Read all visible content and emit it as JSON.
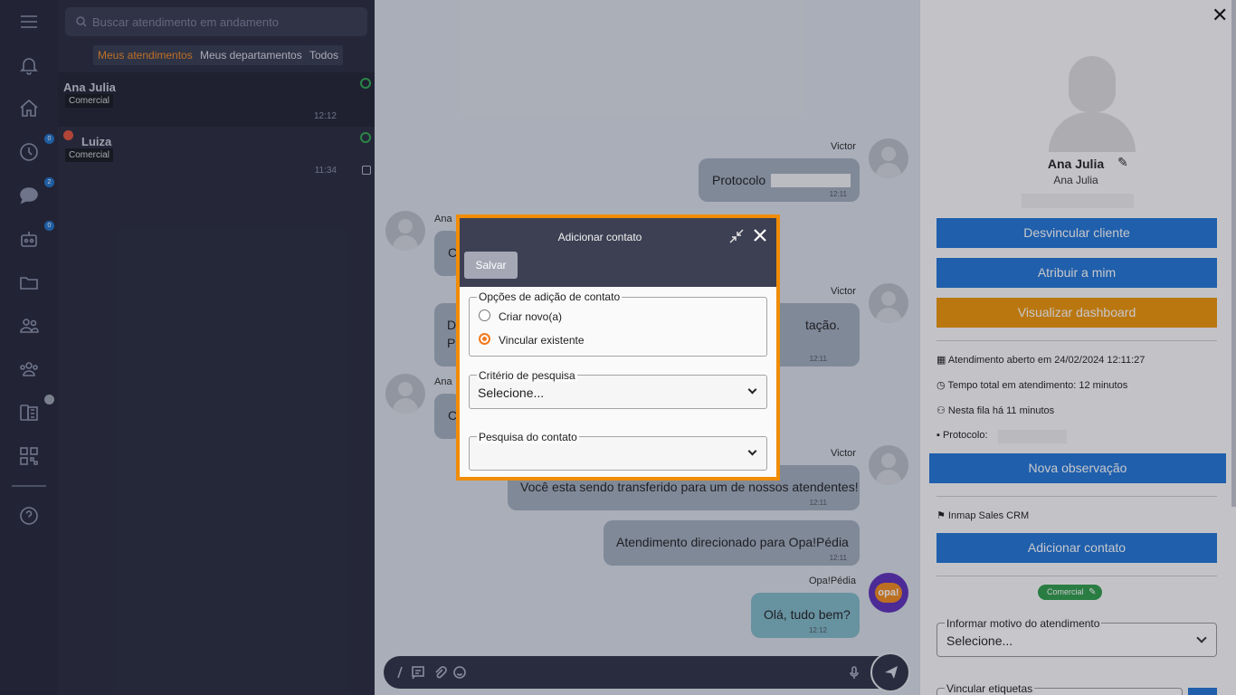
{
  "rail": {
    "badges": [
      "0",
      "2",
      "0"
    ]
  },
  "search": {
    "placeholder": "Buscar atendimento em andamento"
  },
  "filters": [
    "Meus atendimentos",
    "Meus departamentos",
    "Todos"
  ],
  "conversations": [
    {
      "name": "Ana Julia",
      "tag": "Comercial",
      "time": "12:12"
    },
    {
      "name": "Luiza",
      "tag": "Comercial",
      "time": "11:34"
    }
  ],
  "chat": {
    "messages": [
      {
        "author": "Victor",
        "text": "Protocolo",
        "time": "12:11"
      },
      {
        "author": "Ana",
        "text": "C",
        "time": ""
      },
      {
        "author": "Victor",
        "text_start": "D",
        "text_end": "tação.",
        "text_line2": "P",
        "time": "12:11"
      },
      {
        "author": "Ana",
        "text": "C",
        "time": ""
      },
      {
        "author": "Victor",
        "text": "Você esta sendo transferido para um de nossos atendentes!",
        "time": "12:11"
      },
      {
        "author": "",
        "text": "Atendimento direcionado para Opa!Pédia",
        "time": "12:11"
      },
      {
        "author": "Opa!Pédia",
        "text": "Olá, tudo bem?",
        "time": "12:12"
      }
    ],
    "bot_avatar_text": "opa!"
  },
  "contact": {
    "name": "Ana Julia",
    "subname": "Ana Julia",
    "buttons": {
      "unlink": "Desvincular cliente",
      "assign": "Atribuir a mim",
      "dashboard": "Visualizar dashboard",
      "note": "Nova observação",
      "add_contact": "Adicionar contato"
    },
    "opened": "Atendimento aberto em 24/02/2024 12:11:27",
    "total_time": "Tempo total em atendimento: 12 minutos",
    "queue": "Nesta fila há 11 minutos",
    "protocol_label": "Protocolo:",
    "crm": "Inmap Sales CRM",
    "department_tag": "Comercial",
    "reason_label": "Informar motivo do atendimento",
    "reason_value": "Selecione...",
    "tags_label": "Vincular etiquetas"
  },
  "modal": {
    "title": "Adicionar contato",
    "save": "Salvar",
    "options_legend": "Opções de adição de contato",
    "option_new": "Criar novo(a)",
    "option_link": "Vincular existente",
    "selected_option": "Vincular existente",
    "criteria_label": "Critério de pesquisa",
    "criteria_value": "Selecione...",
    "search_label": "Pesquisa do contato",
    "search_value": ""
  },
  "colors": {
    "accent": "#f08c06",
    "primary": "#1f74d6",
    "dashboard": "#ee9406",
    "tag": "#2e9c48"
  }
}
